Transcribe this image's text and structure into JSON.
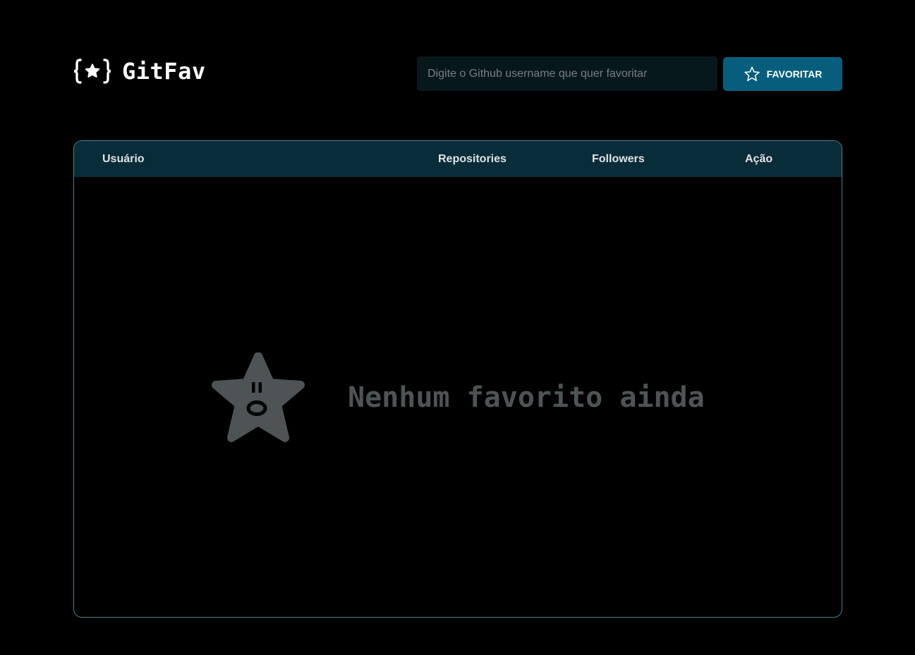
{
  "header": {
    "logo_text": "GitFav",
    "search": {
      "placeholder": "Digite o Github username que quer favoritar",
      "value": ""
    },
    "favorite_button_label": "FAVORITAR",
    "favorite_button_icon": "star-outline-icon"
  },
  "table": {
    "columns": [
      "Usuário",
      "Repositories",
      "Followers",
      "Ação"
    ],
    "rows": [],
    "empty_state": {
      "message": "Nenhum favorito ainda",
      "icon": "surprised-star-icon"
    }
  },
  "colors": {
    "background": "#000000",
    "input_background": "#06181c",
    "button_accent": "#065e7c",
    "table_header": "#092d38",
    "table_border": "#4a808c",
    "empty_state_gray": "#4e5455"
  }
}
